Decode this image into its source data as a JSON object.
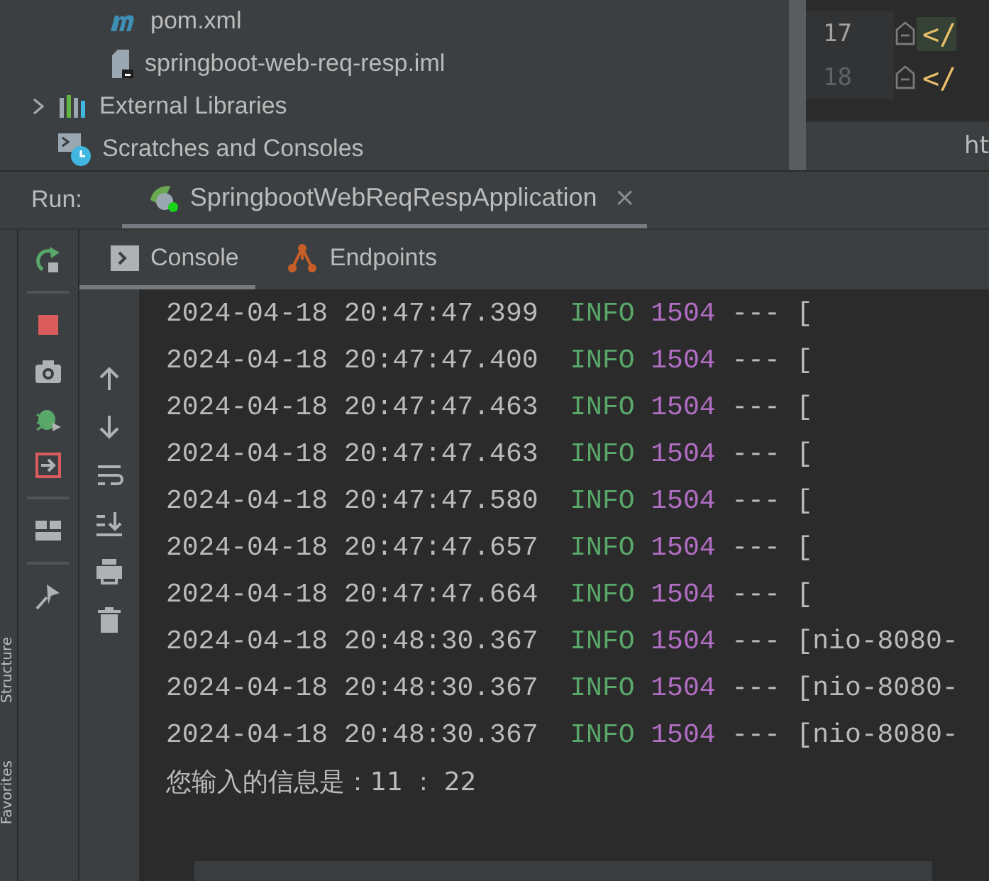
{
  "project_tree": [
    {
      "kind": "maven",
      "label": "pom.xml"
    },
    {
      "kind": "iml",
      "label": "springboot-web-req-resp.iml"
    },
    {
      "kind": "libraries",
      "label": "External Libraries",
      "expandable": true
    },
    {
      "kind": "scratches",
      "label": "Scratches and Consoles",
      "expandable": false
    }
  ],
  "editor": {
    "lines": [
      {
        "number": "17",
        "code": "</",
        "current": true
      },
      {
        "number": "18",
        "code": "</",
        "current": false
      }
    ],
    "breadcrumb": "ht"
  },
  "run_bar": {
    "label": "Run:",
    "tab": "SpringbootWebReqRespApplication",
    "close": "×"
  },
  "side_tabs": [
    "Structure",
    "Favorites"
  ],
  "console_tabs": [
    {
      "kind": "console",
      "label": "Console",
      "selected": true
    },
    {
      "kind": "endpoints",
      "label": "Endpoints",
      "selected": false
    }
  ],
  "log": [
    {
      "time": "2024-04-18 20:47:47.399",
      "level": "INFO",
      "pid": "1504",
      "sep": "---",
      "thread": "["
    },
    {
      "time": "2024-04-18 20:47:47.400",
      "level": "INFO",
      "pid": "1504",
      "sep": "---",
      "thread": "["
    },
    {
      "time": "2024-04-18 20:47:47.463",
      "level": "INFO",
      "pid": "1504",
      "sep": "---",
      "thread": "["
    },
    {
      "time": "2024-04-18 20:47:47.463",
      "level": "INFO",
      "pid": "1504",
      "sep": "---",
      "thread": "["
    },
    {
      "time": "2024-04-18 20:47:47.580",
      "level": "INFO",
      "pid": "1504",
      "sep": "---",
      "thread": "["
    },
    {
      "time": "2024-04-18 20:47:47.657",
      "level": "INFO",
      "pid": "1504",
      "sep": "---",
      "thread": "["
    },
    {
      "time": "2024-04-18 20:47:47.664",
      "level": "INFO",
      "pid": "1504",
      "sep": "---",
      "thread": "["
    },
    {
      "time": "2024-04-18 20:48:30.367",
      "level": "INFO",
      "pid": "1504",
      "sep": "---",
      "thread": "[nio-8080-"
    },
    {
      "time": "2024-04-18 20:48:30.367",
      "level": "INFO",
      "pid": "1504",
      "sep": "---",
      "thread": "[nio-8080-"
    },
    {
      "time": "2024-04-18 20:48:30.367",
      "level": "INFO",
      "pid": "1504",
      "sep": "---",
      "thread": "[nio-8080-"
    }
  ],
  "output": "您输入的信息是：11  :  22"
}
